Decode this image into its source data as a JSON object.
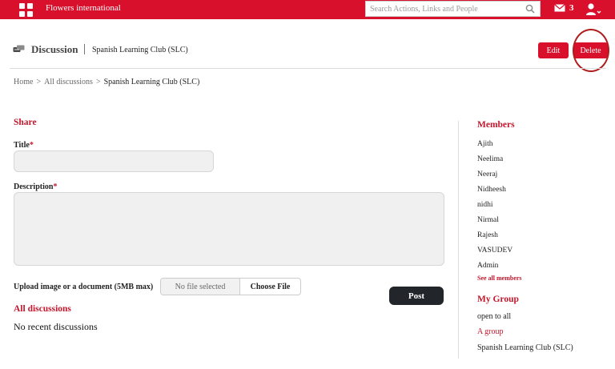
{
  "topbar": {
    "brand": "Flowers international",
    "search_placeholder": "Search Actions, Links and People",
    "mail_count": "3"
  },
  "header": {
    "title": "Discussion",
    "subtitle": "Spanish Learning Club (SLC)",
    "edit_label": "Edit",
    "delete_label": "Delete"
  },
  "breadcrumb": {
    "items": [
      "Home",
      "All discussions",
      "Spanish Learning Club (SLC)"
    ],
    "separator": ">"
  },
  "share": {
    "heading": "Share",
    "title_label": "Title",
    "description_label": "Description",
    "required_mark": "*",
    "upload_label": "Upload image or a document (5MB max)",
    "file_status": "No file selected",
    "choose_label": "Choose File",
    "post_label": "Post"
  },
  "discussions": {
    "heading": "All discussions",
    "empty_text": "No recent discussions"
  },
  "members": {
    "heading": "Members",
    "names": [
      "Ajith",
      "Neelima",
      "Neeraj",
      "Nidheesh",
      "nidhi",
      "Nirmal",
      "Rajesh",
      "VASUDEV",
      "Admin"
    ],
    "see_all": "See all members"
  },
  "my_group": {
    "heading": "My Group",
    "items": [
      "open to all",
      "A group",
      "Spanish Learning Club (SLC)"
    ]
  },
  "colors": {
    "brand_red": "#d8102c",
    "heading_red": "#c4172c",
    "post_button": "#222529"
  }
}
